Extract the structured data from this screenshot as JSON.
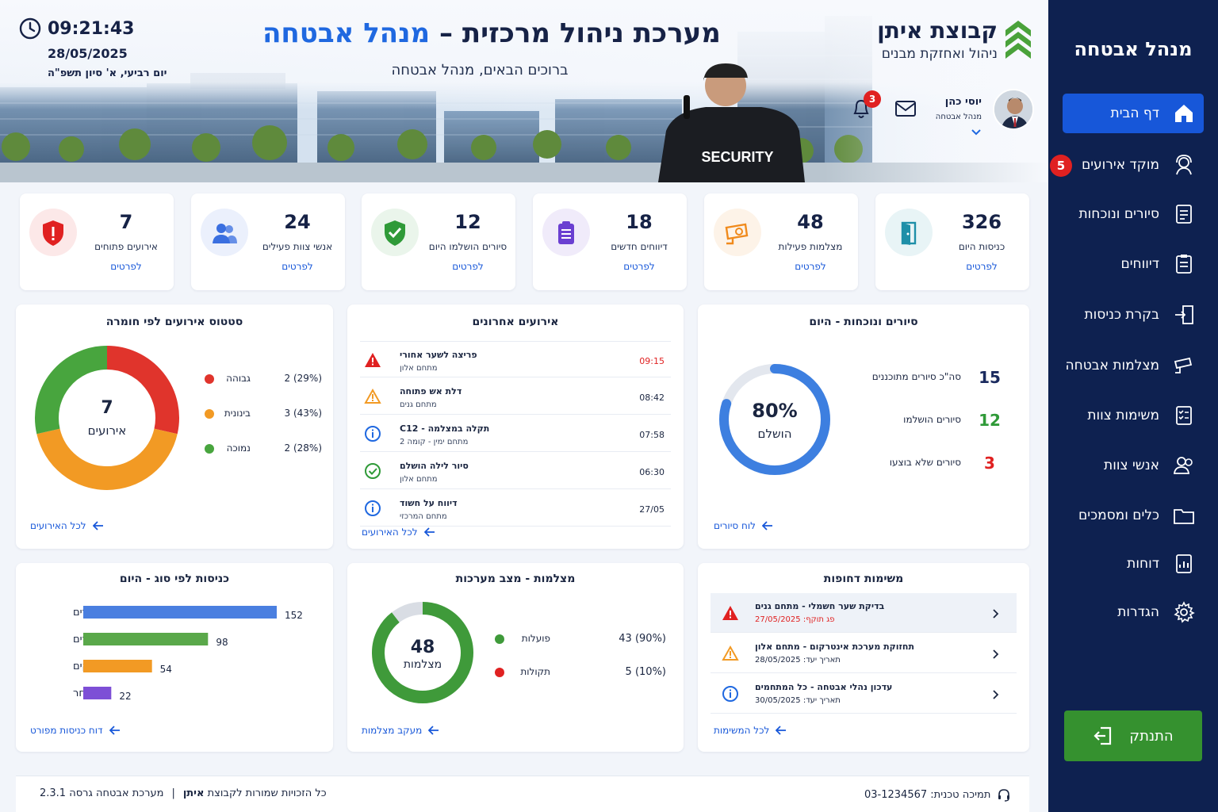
{
  "header": {
    "time": "09:21:43",
    "date": "28/05/2025",
    "hebrew_date": "יום רביעי, א' סיון תשפ\"ה",
    "title_main": "מערכת  ניהול  מרכזית –",
    "title_accent": "מנהל אבטחה",
    "subtitle": "ברוכים הבאים, מנהל אבטחה",
    "brand_name": "קבוצת איתן",
    "brand_tagline": "ניהול ואחזקת מבנים",
    "user_name": "יוסי כהן",
    "user_role": "מנהל אבטחה",
    "notifications_count": "3",
    "security_text": "SECURITY"
  },
  "sidebar": {
    "title": "מנהל אבטחה",
    "items": [
      {
        "label": "דף הבית",
        "icon": "home-icon"
      },
      {
        "label": "מוקד אירועים",
        "icon": "operator-icon",
        "badge": "5"
      },
      {
        "label": "סיורים ונוכחות",
        "icon": "checklist-icon"
      },
      {
        "label": "דיווחים",
        "icon": "clipboard-icon"
      },
      {
        "label": "בקרת כניסות",
        "icon": "entrance-icon"
      },
      {
        "label": "מצלמות אבטחה",
        "icon": "camera-icon"
      },
      {
        "label": "משימות צוות",
        "icon": "tasks-icon"
      },
      {
        "label": "אנשי צוות",
        "icon": "people-icon"
      },
      {
        "label": "כלים ומסמכים",
        "icon": "folder-icon"
      },
      {
        "label": "דוחות",
        "icon": "report-icon"
      },
      {
        "label": "הגדרות",
        "icon": "gear-icon"
      }
    ],
    "logout_label": "התנתק"
  },
  "stats": [
    {
      "value": "326",
      "label": "כניסות היום",
      "link": "לפרטים",
      "icon": "door-icon",
      "color": "#1e8fa8"
    },
    {
      "value": "48",
      "label": "מצלמות פעילות",
      "link": "לפרטים",
      "icon": "camera-icon",
      "color": "#f08a1c"
    },
    {
      "value": "18",
      "label": "דיווחים חדשים",
      "link": "לפרטים",
      "icon": "clipboard-icon",
      "color": "#6a3fd1"
    },
    {
      "value": "12",
      "label": "סיורים הושלמו היום",
      "link": "לפרטים",
      "icon": "shield-check-icon",
      "color": "#2f9a38"
    },
    {
      "value": "24",
      "label": "אנשי צוות פעילים",
      "link": "לפרטים",
      "icon": "people-icon",
      "color": "#3a6fe0"
    },
    {
      "value": "7",
      "label": "אירועים פתוחים",
      "link": "לפרטים",
      "icon": "shield-alert-icon",
      "color": "#e02121"
    }
  ],
  "incident_status": {
    "title": "סטטוס אירועים לפי חומרה",
    "center_value": "7",
    "center_label": "אירועים",
    "link": "לכל האירועים",
    "items": [
      {
        "label": "גבוהה",
        "value": "2 (29%)",
        "color": "#e0342c"
      },
      {
        "label": "בינונית",
        "value": "3 (43%)",
        "color": "#f29a24"
      },
      {
        "label": "נמוכה",
        "value": "2 (28%)",
        "color": "#48a53e"
      }
    ]
  },
  "recent_events": {
    "title": "אירועים אחרונים",
    "link": "לכל האירועים",
    "rows": [
      {
        "title": "פריצה לשער אחורי",
        "location": "מתחם אלון",
        "time": "09:15",
        "icon": "alert-triangle-icon",
        "time_color": "#e02121"
      },
      {
        "title": "דלת אש פתוחה",
        "location": "מתחם גנים",
        "time": "08:42",
        "icon": "warning-triangle-icon",
        "time_color": "#1a2540"
      },
      {
        "title": "תקלה במצלמה - C12",
        "location": "מתחם ימין - קומה 2",
        "time": "07:58",
        "icon": "info-icon",
        "time_color": "#1a2540"
      },
      {
        "title": "סיור לילה הושלם",
        "location": "מתחם אלון",
        "time": "06:30",
        "icon": "check-circle-icon",
        "time_color": "#1a2540"
      },
      {
        "title": "דיווח על חשוד",
        "location": "מתחם המרכזי",
        "time": "27/05",
        "icon": "info-icon",
        "time_color": "#1a2540"
      }
    ]
  },
  "patrols": {
    "title": "סיורים ונוכחות - היום",
    "percent_label": "80%",
    "percent_caption": "הושלם",
    "progress": 0.8,
    "link": "לוח סיורים",
    "rows": [
      {
        "label": "סה\"כ סיורים מתוכננים",
        "value": "15",
        "color": "#1a2a5e"
      },
      {
        "label": "סיורים הושלמו",
        "value": "12",
        "color": "#2f9a38"
      },
      {
        "label": "סיורים שלא בוצעו",
        "value": "3",
        "color": "#e02121"
      }
    ]
  },
  "entries": {
    "title": "כניסות לפי סוג - היום",
    "link": "דוח כניסות מפורט",
    "chart_data": {
      "type": "bar",
      "categories": [
        "עובדים",
        "מבקרים",
        "ספקים",
        "אחר"
      ],
      "values": [
        152,
        98,
        54,
        22
      ],
      "colors": [
        "#4a7fe0",
        "#5aa84a",
        "#f29a24",
        "#7d4fd6"
      ]
    }
  },
  "cameras": {
    "title": "מצלמות - מצב מערכות",
    "center_value": "48",
    "center_label": "מצלמות",
    "link": "מעקב מצלמות",
    "items": [
      {
        "label": "פועלות",
        "value": "43 (90%)",
        "color": "#3f9a3a"
      },
      {
        "label": "תקולות",
        "value": "5 (10%)",
        "color": "#e02121"
      }
    ]
  },
  "urgent_tasks": {
    "title": "משימות דחופות",
    "link": "לכל המשימות",
    "rows": [
      {
        "title": "בדיקת שער חשמלי - מתחם גנים",
        "sub": "פג תוקף: 27/05/2025",
        "icon": "alert-triangle-icon",
        "sub_color": "#e02121"
      },
      {
        "title": "תחזוקת מערכת אינטרקום - מתחם אלון",
        "sub": "תאריך יעד: 28/05/2025",
        "icon": "warning-triangle-icon",
        "sub_color": "#1a2540"
      },
      {
        "title": "עדכון נהלי אבטחה - כל המתחמים",
        "sub": "תאריך יעד: 30/05/2025",
        "icon": "info-icon",
        "sub_color": "#1a2540"
      }
    ]
  },
  "footer": {
    "support": "תמיכה טכנית: 03-1234567",
    "copyright_pre": "כל הזכויות שמורות לקבוצת",
    "copyright_brand": "איתן",
    "version": "מערכת אבטחה גרסה 2.3.1"
  }
}
